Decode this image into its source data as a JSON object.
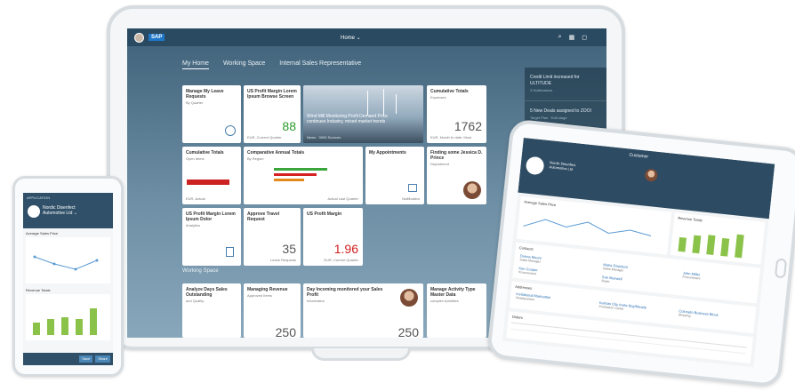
{
  "monitor": {
    "shell": {
      "logo": "SAP",
      "title": "Home ⌄",
      "icons": [
        "search-icon",
        "grid-icon",
        "bell-icon"
      ]
    },
    "tabs": [
      "My Home",
      "Working Space",
      "Internal Sales Representative"
    ],
    "tiles": {
      "leave": {
        "title": "Manage My Leave Requests",
        "subtitle": "By Quarter"
      },
      "profit_margin_top": {
        "title": "US Profit Margin Lorem Ipsum Browse Screen",
        "value": "88",
        "footer": "EUR, Current Quarter"
      },
      "news": {
        "caption": "Wind Mill Monitoring Profil Demand Price continues Industry, mixed market trends",
        "source": "News  ·  3000 Sources"
      },
      "cumulative_top": {
        "title": "Cumulative Totals",
        "subtitle": "Expenses",
        "value": "1762",
        "footer": "EUR, Month to date, Most"
      },
      "cumulative_bar": {
        "title": "Cumulative Totals",
        "subtitle": "Open items",
        "footer": "EUR, Actual"
      },
      "comparative": {
        "title": "Comparative Annual Totals",
        "subtitle": "By Region",
        "footer": "Actual Last Quarter"
      },
      "appointments": {
        "title": "My Appointments",
        "footer": "Notification"
      },
      "profile": {
        "title": "Finding some Jessica D. Prince",
        "subtitle": "Department"
      },
      "us_margin_form": {
        "title": "US Profit Margin Lorem Ipsum Dolor",
        "subtitle": "Analytics"
      },
      "travel": {
        "title": "Approve Travel Request",
        "value": "35",
        "footer": "Leave Requests"
      },
      "us_margin": {
        "title": "US Profit Margin",
        "value": "1.96",
        "footer": "EUR, Current Quarter"
      }
    },
    "side_panel": [
      {
        "text": "Credit Limit increased for ULTITUDE",
        "small": "3 Notifications"
      },
      {
        "text": "5 New Deals assigned to ZOOI",
        "small": "Target Plan  ·  Edit stage"
      }
    ],
    "section_label": "Working Space",
    "bottom_tiles": [
      {
        "title": "Analyze Days Sales Outstanding",
        "subtitle": "and Quality"
      },
      {
        "title": "Managing Revenue",
        "subtitle": "Approved Items",
        "value": "250"
      },
      {
        "title": "Day Incoming monitored your Sales Profit",
        "subtitle": "Information",
        "value": "250"
      },
      {
        "title": "Manage Activity Type Master Data",
        "subtitle": "complex Activities"
      }
    ]
  },
  "phone": {
    "status": "APPLICATION",
    "title_line1": "Nordic Disenfect",
    "title_line2": "Automotive Ltd ⌄",
    "chart1_label": "Average Sales Price",
    "chart2_label": "Revenue Totals",
    "footer_btn1": "Save",
    "footer_btn2": "Share"
  },
  "tablet": {
    "title": "Customer",
    "company_line1": "Nordic Disenfect",
    "company_line2": "Automotive Ltd",
    "chart1_label": "Average Sales Price",
    "chart2_label": "Revenue Totals",
    "contacts_label": "Contacts",
    "contacts": [
      {
        "name": "Donna Moore",
        "role": "Sales Manager"
      },
      {
        "name": "Maria Davidson",
        "role": "Sales Manager"
      },
      {
        "name": "John Miller",
        "role": "Procurement"
      },
      {
        "name": "Ken Cooper",
        "role": "Procurement"
      },
      {
        "name": "Sue Maxwell",
        "role": "Buyer"
      }
    ],
    "addresses_label": "Addresses",
    "addresses": [
      {
        "title": "Invitational Manhattan",
        "line": "Headquarters"
      },
      {
        "title": "Kansas City Invite Bay/Meade",
        "line": "Production Center"
      },
      {
        "title": "Colorado Business Block",
        "line": "Shipping"
      }
    ],
    "orders_label": "Orders"
  },
  "colors": {
    "shell": "#2a4a61",
    "positive": "#2b9c2b",
    "negative": "#d21f1f",
    "accent": "#1f77c9",
    "tablet_bars": "#8bc34a"
  }
}
